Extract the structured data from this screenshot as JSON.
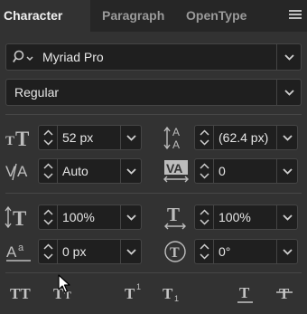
{
  "tabs": [
    {
      "label": "Character",
      "active": true
    },
    {
      "label": "Paragraph",
      "active": false
    },
    {
      "label": "OpenType",
      "active": false
    }
  ],
  "font_family": {
    "value": "Myriad Pro",
    "icon": "search-icon"
  },
  "font_style": {
    "value": "Regular"
  },
  "fields": {
    "font_size": {
      "value": "52 px",
      "icon": "font-size-icon"
    },
    "leading": {
      "value": "(62.4 px)",
      "icon": "leading-icon"
    },
    "kerning": {
      "value": "Auto",
      "icon": "kerning-icon"
    },
    "tracking": {
      "value": "0",
      "icon": "tracking-icon"
    },
    "vertical_scale": {
      "value": "100%",
      "icon": "vertical-scale-icon"
    },
    "horizontal_scale": {
      "value": "100%",
      "icon": "horizontal-scale-icon"
    },
    "baseline_shift": {
      "value": "0 px",
      "icon": "baseline-shift-icon"
    },
    "character_rotation": {
      "value": "0°",
      "icon": "character-rotation-icon"
    }
  },
  "style_buttons": [
    {
      "name": "all-caps-button",
      "glyph": "TT"
    },
    {
      "name": "small-caps-button",
      "glyph": "Tт"
    },
    {
      "name": "superscript-button",
      "glyph": "T¹"
    },
    {
      "name": "subscript-button",
      "glyph": "T₁"
    },
    {
      "name": "underline-button",
      "glyph": "T"
    },
    {
      "name": "strikethrough-button",
      "glyph": "T"
    }
  ],
  "colors": {
    "panel": "#323232",
    "tabbar": "#262626",
    "field": "#1f1f1f",
    "text": "#e6e6e6",
    "icon": "#bdbdbd"
  }
}
